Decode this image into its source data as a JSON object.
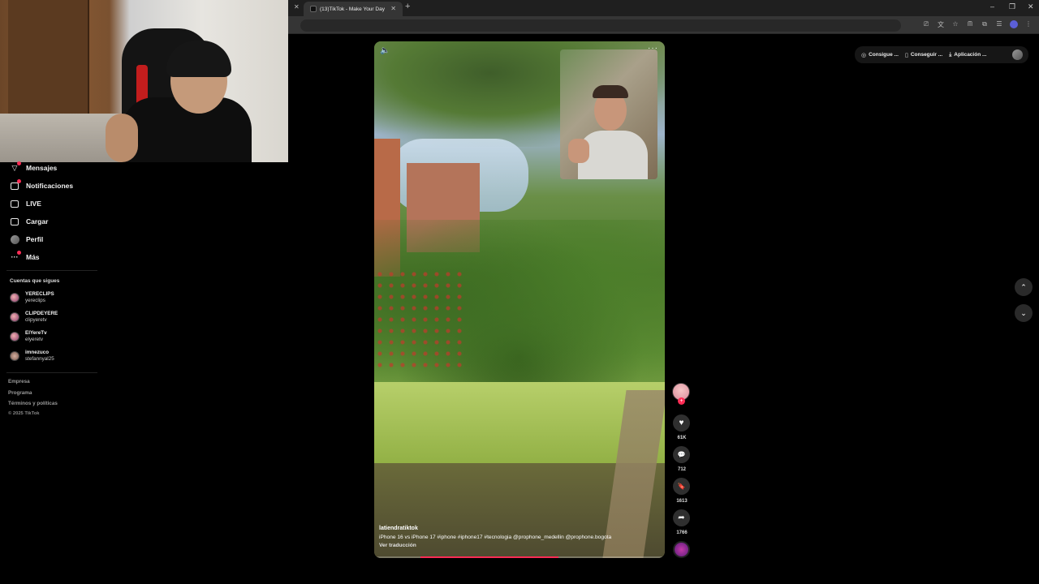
{
  "browser": {
    "active_tab_title": "(13)TikTok - Make Your Day"
  },
  "sidebar": {
    "items": [
      {
        "label": "Mensajes"
      },
      {
        "label": "Notificaciones"
      },
      {
        "label": "LIVE"
      },
      {
        "label": "Cargar"
      },
      {
        "label": "Perfil"
      },
      {
        "label": "Más"
      }
    ],
    "following_title": "Cuentas que sigues",
    "following": [
      {
        "name": "YERECLIPS",
        "user": "yereclips"
      },
      {
        "name": "CLIPDEYERE",
        "user": "clipyeretv"
      },
      {
        "name": "ElYereTv",
        "user": "elyeretv"
      },
      {
        "name": "imnezuco",
        "user": "stefannyal25"
      }
    ],
    "footer": [
      "Empresa",
      "Programa",
      "Términos y políticas",
      "© 2025 TikTok"
    ]
  },
  "video": {
    "author": "latiendratiktok",
    "caption": "iPhone 16 vs iPhone 17 #iphone #iphone17 #tecnologia @prophone_medellin @prophone.bogota",
    "translate": "Ver traducción",
    "progress": 0.5
  },
  "actions": {
    "likes": "61K",
    "comments": "712",
    "saves": "1613",
    "shares": "1766"
  },
  "top_links": [
    "Consigue ...",
    "Conseguir ...",
    "Aplicación ..."
  ],
  "icons": {
    "volume": "🔈",
    "more": "···",
    "heart": "♥",
    "comment": "💬",
    "bookmark": "🔖",
    "share": "➦",
    "up": "⌃",
    "down": "⌄"
  }
}
